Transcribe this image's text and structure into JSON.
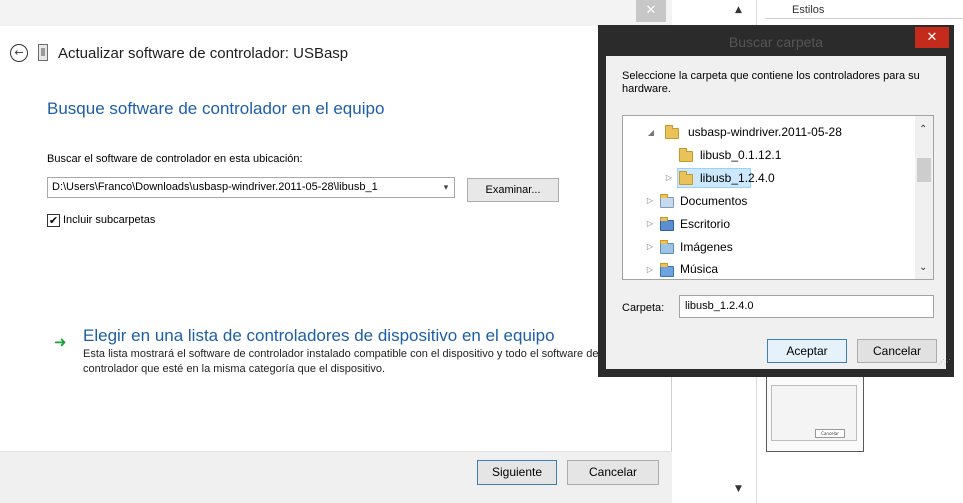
{
  "wizard": {
    "title": "Actualizar software de controlador: USBasp",
    "heading": "Busque software de controlador en el equipo",
    "search_label": "Buscar el software de controlador en esta ubicación:",
    "path_value": "D:\\Users\\Franco\\Downloads\\usbasp-windriver.2011-05-28\\libusb_1",
    "browse_label": "Examinar...",
    "include_subfolders_label": "Incluir subcarpetas",
    "include_subfolders_checked": true,
    "link_title": "Elegir en una lista de controladores de dispositivo en el equipo",
    "link_description": "Esta lista mostrará el software de controlador instalado compatible con el dispositivo y todo el software de controlador que esté en la misma categoría que el dispositivo.",
    "next_label": "Siguiente",
    "cancel_label": "Cancelar"
  },
  "right_panel": {
    "styles_label": "Estilos",
    "mini_cancel_label": "Cancelar"
  },
  "dialog": {
    "title": "Buscar carpeta",
    "instruction": "Seleccione la carpeta que contiene los controladores para su hardware.",
    "tree": [
      {
        "label": "usbasp-windriver.2011-05-28",
        "icon": "folder-icon",
        "expanded": true
      },
      {
        "label": "libusb_0.1.12.1",
        "icon": "folder-icon"
      },
      {
        "label": "libusb_1.2.4.0",
        "icon": "folder-icon",
        "selected": true
      },
      {
        "label": "Documentos",
        "icon": "documents-folder-icon"
      },
      {
        "label": "Escritorio",
        "icon": "desktop-folder-icon"
      },
      {
        "label": "Imágenes",
        "icon": "pictures-folder-icon"
      },
      {
        "label": "Música",
        "icon": "music-folder-icon"
      }
    ],
    "folder_label": "Carpeta:",
    "folder_value": "libusb_1.2.4.0",
    "ok_label": "Aceptar",
    "cancel_label": "Cancelar"
  },
  "colors": {
    "link_blue": "#1d5fa7",
    "close_red": "#c42b1c",
    "selection": "#cce8ff",
    "dialog_frame": "#2b2b2b"
  }
}
